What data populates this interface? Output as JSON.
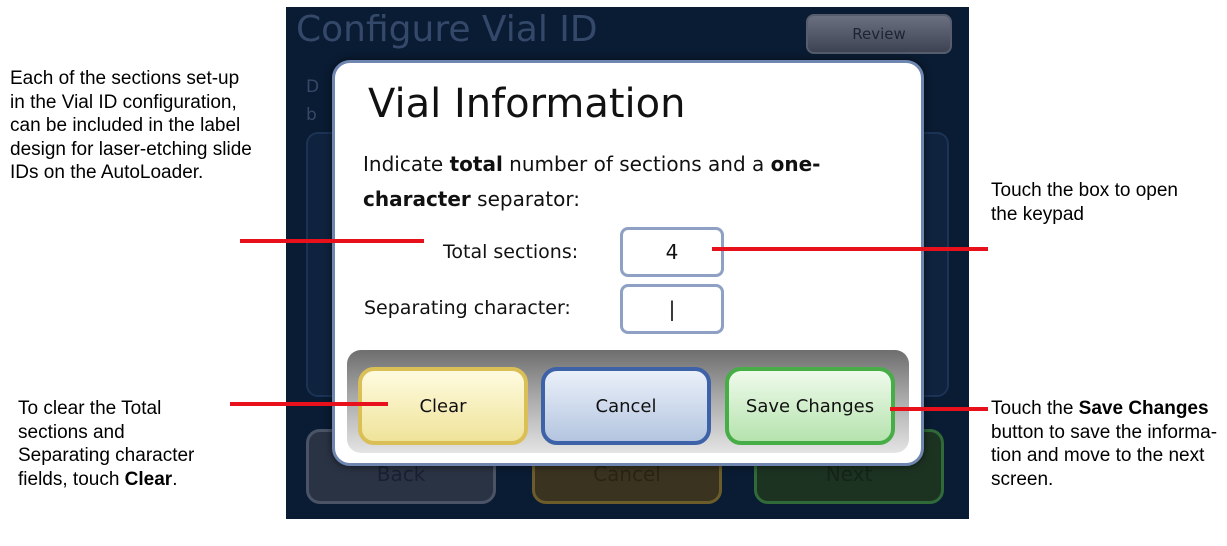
{
  "screen": {
    "background_title": "Configure Vial ID",
    "review_button": "Review",
    "bg_line1": "D",
    "bg_line2": "b",
    "bg_back": "Back",
    "bg_cancel": "Cancel",
    "bg_next": "Next"
  },
  "dialog": {
    "title": "Vial Information",
    "instruction_parts": [
      "Indicate ",
      "total",
      " number of sections and a ",
      "one-character",
      " separator:"
    ],
    "total_sections_label": "Total sections:",
    "total_sections_value": "4",
    "separator_label": "Separating character:",
    "separator_value": "|",
    "clear_label": "Clear",
    "cancel_label": "Cancel",
    "save_label": "Save Changes"
  },
  "annotations": {
    "left_top": "Each of the sections set-up in the Vial ID configuration, can be included in the label design for laser-etching slide IDs on the AutoLoader.",
    "left_bottom_pre": "To clear the Total sections and Separating character fields, touch ",
    "left_bottom_bold": "Clear",
    "left_bottom_post": ".",
    "right_top": "Touch the box to open the keypad",
    "right_bottom_pre": "Touch the ",
    "right_bottom_bold": "Save Changes",
    "right_bottom_post": " button to save the informa-tion and move to the next screen."
  },
  "colors": {
    "callout_line": "#e8101a",
    "screen_bg": "#0a1c33",
    "clear_fill": "#f6efb2",
    "cancel_fill": "#c7d3e6",
    "save_fill": "#c9ecc5"
  }
}
